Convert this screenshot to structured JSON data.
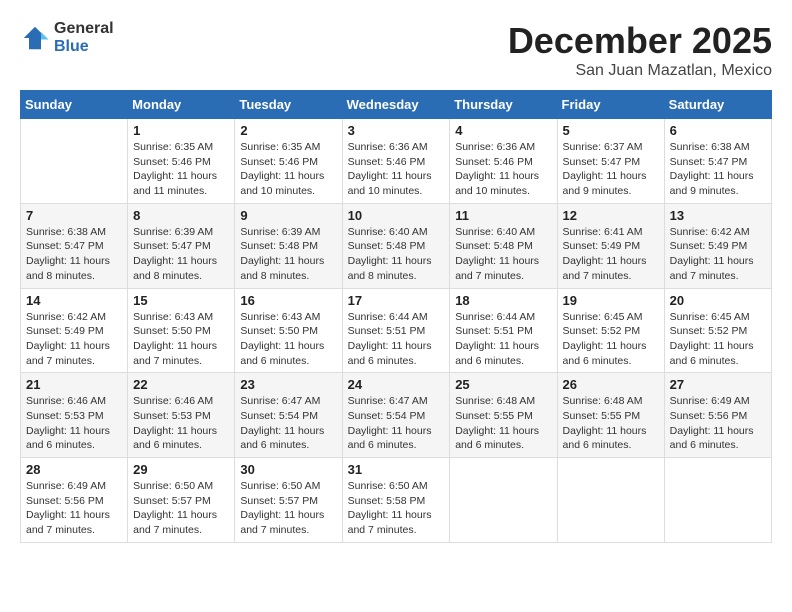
{
  "header": {
    "logo_general": "General",
    "logo_blue": "Blue",
    "month_title": "December 2025",
    "subtitle": "San Juan Mazatlan, Mexico"
  },
  "days_of_week": [
    "Sunday",
    "Monday",
    "Tuesday",
    "Wednesday",
    "Thursday",
    "Friday",
    "Saturday"
  ],
  "weeks": [
    [
      {
        "day": "",
        "sunrise": "",
        "sunset": "",
        "daylight": ""
      },
      {
        "day": "1",
        "sunrise": "Sunrise: 6:35 AM",
        "sunset": "Sunset: 5:46 PM",
        "daylight": "Daylight: 11 hours and 11 minutes."
      },
      {
        "day": "2",
        "sunrise": "Sunrise: 6:35 AM",
        "sunset": "Sunset: 5:46 PM",
        "daylight": "Daylight: 11 hours and 10 minutes."
      },
      {
        "day": "3",
        "sunrise": "Sunrise: 6:36 AM",
        "sunset": "Sunset: 5:46 PM",
        "daylight": "Daylight: 11 hours and 10 minutes."
      },
      {
        "day": "4",
        "sunrise": "Sunrise: 6:36 AM",
        "sunset": "Sunset: 5:46 PM",
        "daylight": "Daylight: 11 hours and 10 minutes."
      },
      {
        "day": "5",
        "sunrise": "Sunrise: 6:37 AM",
        "sunset": "Sunset: 5:47 PM",
        "daylight": "Daylight: 11 hours and 9 minutes."
      },
      {
        "day": "6",
        "sunrise": "Sunrise: 6:38 AM",
        "sunset": "Sunset: 5:47 PM",
        "daylight": "Daylight: 11 hours and 9 minutes."
      }
    ],
    [
      {
        "day": "7",
        "sunrise": "Sunrise: 6:38 AM",
        "sunset": "Sunset: 5:47 PM",
        "daylight": "Daylight: 11 hours and 8 minutes."
      },
      {
        "day": "8",
        "sunrise": "Sunrise: 6:39 AM",
        "sunset": "Sunset: 5:47 PM",
        "daylight": "Daylight: 11 hours and 8 minutes."
      },
      {
        "day": "9",
        "sunrise": "Sunrise: 6:39 AM",
        "sunset": "Sunset: 5:48 PM",
        "daylight": "Daylight: 11 hours and 8 minutes."
      },
      {
        "day": "10",
        "sunrise": "Sunrise: 6:40 AM",
        "sunset": "Sunset: 5:48 PM",
        "daylight": "Daylight: 11 hours and 8 minutes."
      },
      {
        "day": "11",
        "sunrise": "Sunrise: 6:40 AM",
        "sunset": "Sunset: 5:48 PM",
        "daylight": "Daylight: 11 hours and 7 minutes."
      },
      {
        "day": "12",
        "sunrise": "Sunrise: 6:41 AM",
        "sunset": "Sunset: 5:49 PM",
        "daylight": "Daylight: 11 hours and 7 minutes."
      },
      {
        "day": "13",
        "sunrise": "Sunrise: 6:42 AM",
        "sunset": "Sunset: 5:49 PM",
        "daylight": "Daylight: 11 hours and 7 minutes."
      }
    ],
    [
      {
        "day": "14",
        "sunrise": "Sunrise: 6:42 AM",
        "sunset": "Sunset: 5:49 PM",
        "daylight": "Daylight: 11 hours and 7 minutes."
      },
      {
        "day": "15",
        "sunrise": "Sunrise: 6:43 AM",
        "sunset": "Sunset: 5:50 PM",
        "daylight": "Daylight: 11 hours and 7 minutes."
      },
      {
        "day": "16",
        "sunrise": "Sunrise: 6:43 AM",
        "sunset": "Sunset: 5:50 PM",
        "daylight": "Daylight: 11 hours and 6 minutes."
      },
      {
        "day": "17",
        "sunrise": "Sunrise: 6:44 AM",
        "sunset": "Sunset: 5:51 PM",
        "daylight": "Daylight: 11 hours and 6 minutes."
      },
      {
        "day": "18",
        "sunrise": "Sunrise: 6:44 AM",
        "sunset": "Sunset: 5:51 PM",
        "daylight": "Daylight: 11 hours and 6 minutes."
      },
      {
        "day": "19",
        "sunrise": "Sunrise: 6:45 AM",
        "sunset": "Sunset: 5:52 PM",
        "daylight": "Daylight: 11 hours and 6 minutes."
      },
      {
        "day": "20",
        "sunrise": "Sunrise: 6:45 AM",
        "sunset": "Sunset: 5:52 PM",
        "daylight": "Daylight: 11 hours and 6 minutes."
      }
    ],
    [
      {
        "day": "21",
        "sunrise": "Sunrise: 6:46 AM",
        "sunset": "Sunset: 5:53 PM",
        "daylight": "Daylight: 11 hours and 6 minutes."
      },
      {
        "day": "22",
        "sunrise": "Sunrise: 6:46 AM",
        "sunset": "Sunset: 5:53 PM",
        "daylight": "Daylight: 11 hours and 6 minutes."
      },
      {
        "day": "23",
        "sunrise": "Sunrise: 6:47 AM",
        "sunset": "Sunset: 5:54 PM",
        "daylight": "Daylight: 11 hours and 6 minutes."
      },
      {
        "day": "24",
        "sunrise": "Sunrise: 6:47 AM",
        "sunset": "Sunset: 5:54 PM",
        "daylight": "Daylight: 11 hours and 6 minutes."
      },
      {
        "day": "25",
        "sunrise": "Sunrise: 6:48 AM",
        "sunset": "Sunset: 5:55 PM",
        "daylight": "Daylight: 11 hours and 6 minutes."
      },
      {
        "day": "26",
        "sunrise": "Sunrise: 6:48 AM",
        "sunset": "Sunset: 5:55 PM",
        "daylight": "Daylight: 11 hours and 6 minutes."
      },
      {
        "day": "27",
        "sunrise": "Sunrise: 6:49 AM",
        "sunset": "Sunset: 5:56 PM",
        "daylight": "Daylight: 11 hours and 6 minutes."
      }
    ],
    [
      {
        "day": "28",
        "sunrise": "Sunrise: 6:49 AM",
        "sunset": "Sunset: 5:56 PM",
        "daylight": "Daylight: 11 hours and 7 minutes."
      },
      {
        "day": "29",
        "sunrise": "Sunrise: 6:50 AM",
        "sunset": "Sunset: 5:57 PM",
        "daylight": "Daylight: 11 hours and 7 minutes."
      },
      {
        "day": "30",
        "sunrise": "Sunrise: 6:50 AM",
        "sunset": "Sunset: 5:57 PM",
        "daylight": "Daylight: 11 hours and 7 minutes."
      },
      {
        "day": "31",
        "sunrise": "Sunrise: 6:50 AM",
        "sunset": "Sunset: 5:58 PM",
        "daylight": "Daylight: 11 hours and 7 minutes."
      },
      {
        "day": "",
        "sunrise": "",
        "sunset": "",
        "daylight": ""
      },
      {
        "day": "",
        "sunrise": "",
        "sunset": "",
        "daylight": ""
      },
      {
        "day": "",
        "sunrise": "",
        "sunset": "",
        "daylight": ""
      }
    ]
  ]
}
